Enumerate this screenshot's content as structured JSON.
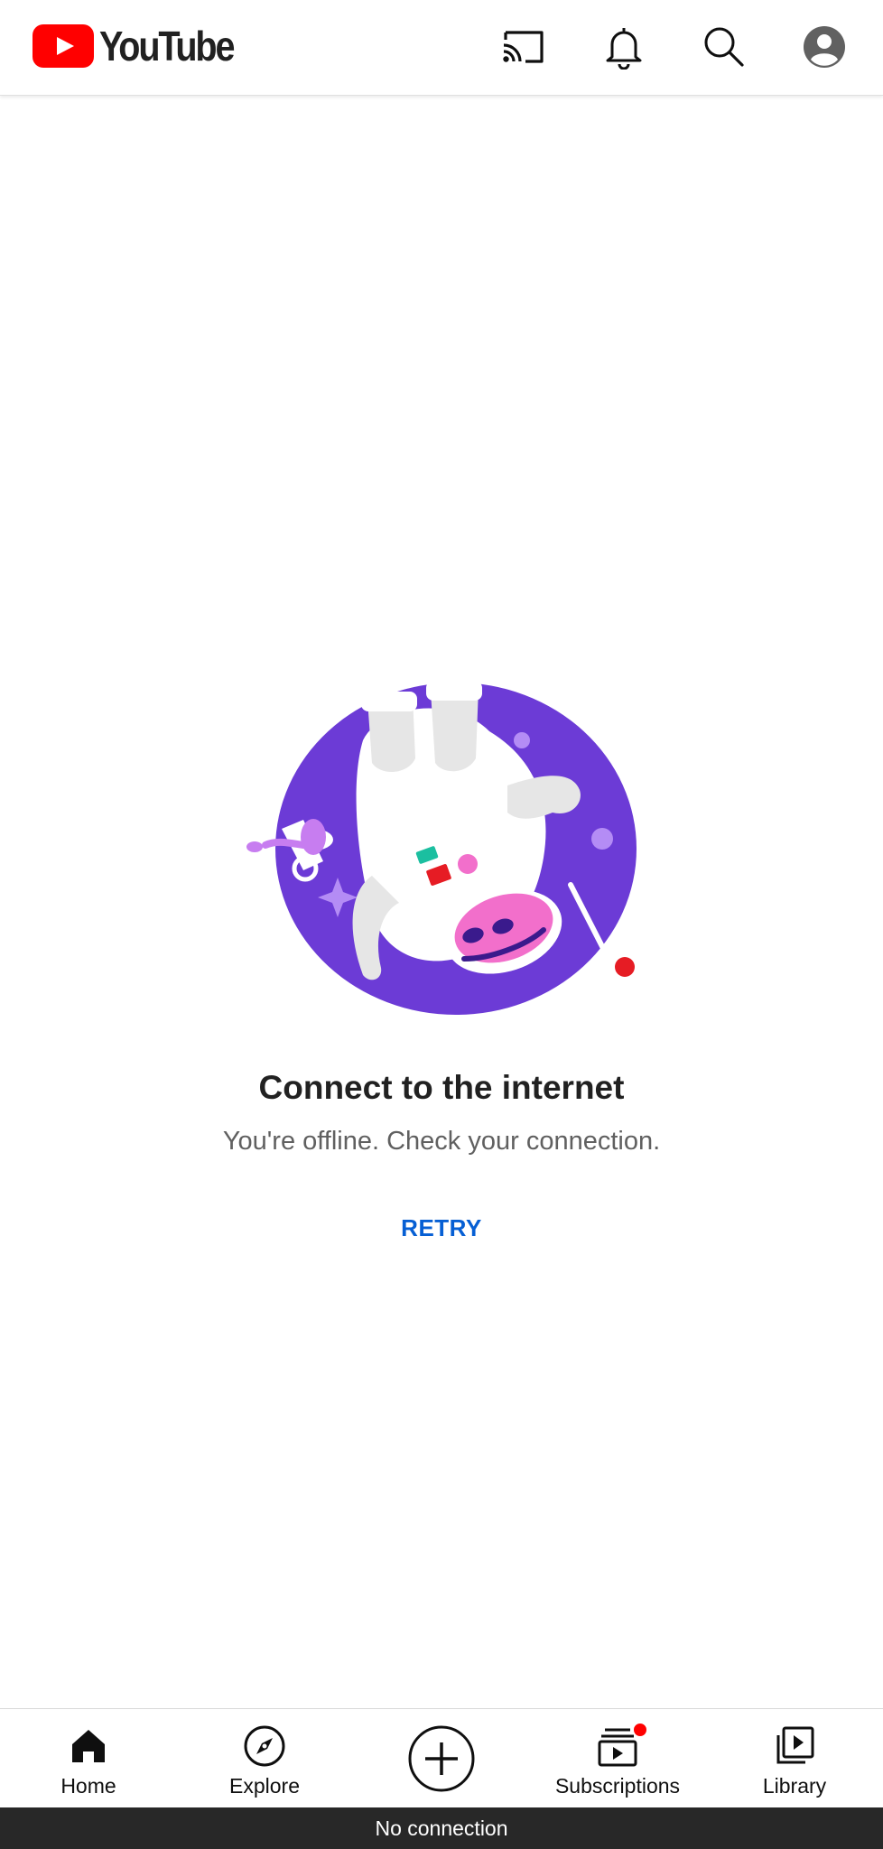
{
  "app": {
    "logo_text": "YouTube",
    "brand_red": "#FF0000"
  },
  "header": {
    "icons": [
      "cast-icon",
      "bell-icon",
      "search-icon",
      "account-icon"
    ]
  },
  "empty_state": {
    "title": "Connect to the internet",
    "message": "You're offline. Check your connection.",
    "retry_label": "RETRY",
    "illustration": "offline-astronaut-illustration"
  },
  "bottom_nav": {
    "items": [
      {
        "label": "Home",
        "icon": "home-icon",
        "selected": true
      },
      {
        "label": "Explore",
        "icon": "compass-icon"
      },
      {
        "label": "",
        "icon": "create-plus-icon"
      },
      {
        "label": "Subscriptions",
        "icon": "subscriptions-icon",
        "has_notification_dot": true
      },
      {
        "label": "Library",
        "icon": "library-icon"
      }
    ]
  },
  "status_bar": {
    "text": "No connection"
  },
  "colors": {
    "accent_blue": "#065FD4",
    "illustration_purple": "#6C3BD6"
  }
}
